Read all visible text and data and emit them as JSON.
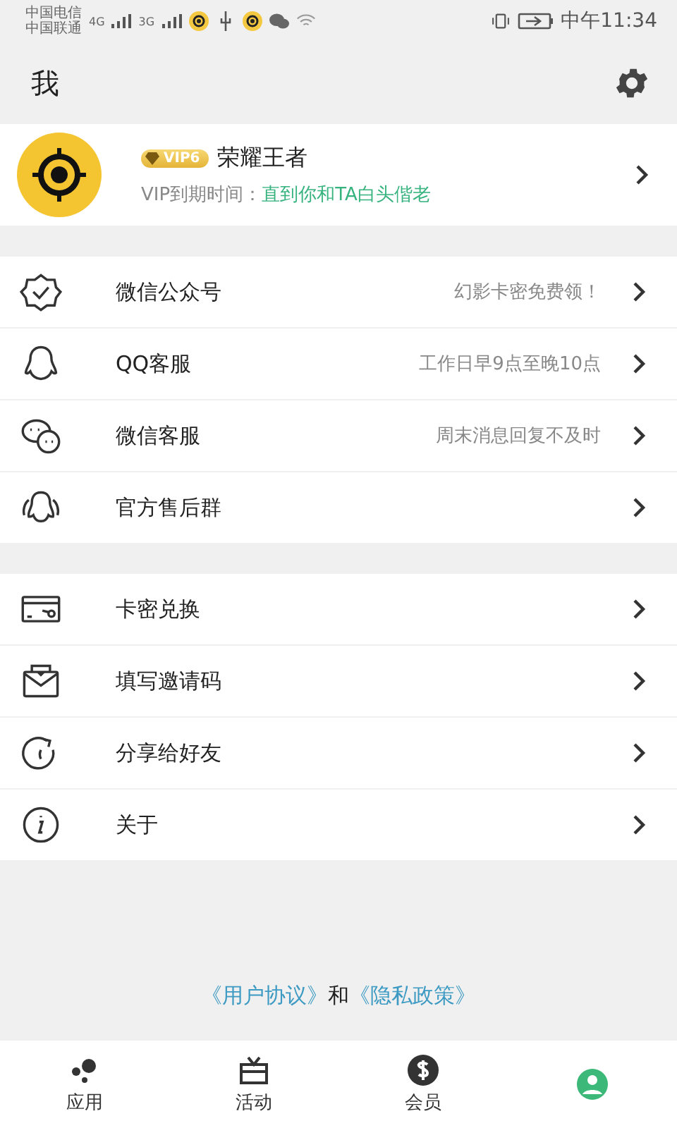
{
  "status_bar": {
    "carriers": [
      "中国电信",
      "中国联通"
    ],
    "networks": [
      "4G",
      "3G"
    ],
    "time": "中午11:34"
  },
  "header": {
    "title": "我"
  },
  "profile": {
    "badge": "VIP6",
    "name": "荣耀王者",
    "vip_label": "VIP到期时间：",
    "vip_value": "直到你和TA白头偕老"
  },
  "groups": [
    {
      "items": [
        {
          "kind": "badge",
          "label": "微信公众号",
          "note": "幻影卡密免费领！"
        },
        {
          "kind": "qq",
          "label": "QQ客服",
          "note": "工作日早9点至晚10点"
        },
        {
          "kind": "chat",
          "label": "微信客服",
          "note": "周末消息回复不及时"
        },
        {
          "kind": "group",
          "label": "官方售后群"
        }
      ]
    },
    {
      "items": [
        {
          "kind": "card",
          "label": "卡密兑换"
        },
        {
          "kind": "mail",
          "label": "填写邀请码"
        },
        {
          "kind": "share",
          "label": "分享给好友"
        },
        {
          "kind": "info",
          "label": "关于"
        }
      ]
    }
  ],
  "footer": {
    "links": [
      "《用户协议》",
      "《隐私政策》"
    ],
    "joiner": "和"
  },
  "tabs": [
    {
      "kind": "apps",
      "label": "应用",
      "selected": false
    },
    {
      "kind": "gift",
      "label": "活动",
      "selected": false
    },
    {
      "kind": "dollar",
      "label": "会员",
      "selected": false
    },
    {
      "kind": "person",
      "selected": true
    }
  ]
}
